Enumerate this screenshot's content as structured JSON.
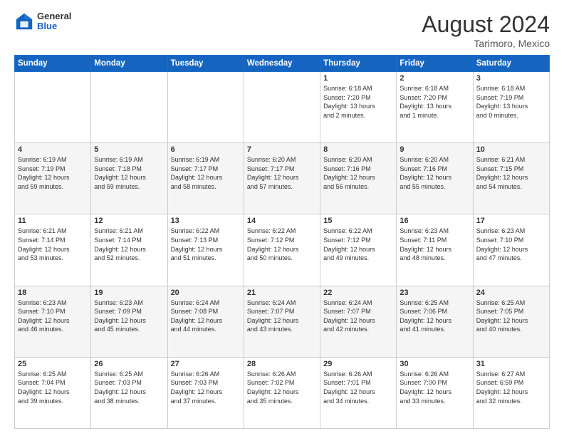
{
  "header": {
    "logo": {
      "general": "General",
      "blue": "Blue"
    },
    "title": "August 2024",
    "location": "Tarimoro, Mexico"
  },
  "weekdays": [
    "Sunday",
    "Monday",
    "Tuesday",
    "Wednesday",
    "Thursday",
    "Friday",
    "Saturday"
  ],
  "weeks": [
    [
      {
        "day": "",
        "info": ""
      },
      {
        "day": "",
        "info": ""
      },
      {
        "day": "",
        "info": ""
      },
      {
        "day": "",
        "info": ""
      },
      {
        "day": "1",
        "info": "Sunrise: 6:18 AM\nSunset: 7:20 PM\nDaylight: 13 hours\nand 2 minutes."
      },
      {
        "day": "2",
        "info": "Sunrise: 6:18 AM\nSunset: 7:20 PM\nDaylight: 13 hours\nand 1 minute."
      },
      {
        "day": "3",
        "info": "Sunrise: 6:18 AM\nSunset: 7:19 PM\nDaylight: 13 hours\nand 0 minutes."
      }
    ],
    [
      {
        "day": "4",
        "info": "Sunrise: 6:19 AM\nSunset: 7:19 PM\nDaylight: 12 hours\nand 59 minutes."
      },
      {
        "day": "5",
        "info": "Sunrise: 6:19 AM\nSunset: 7:18 PM\nDaylight: 12 hours\nand 59 minutes."
      },
      {
        "day": "6",
        "info": "Sunrise: 6:19 AM\nSunset: 7:17 PM\nDaylight: 12 hours\nand 58 minutes."
      },
      {
        "day": "7",
        "info": "Sunrise: 6:20 AM\nSunset: 7:17 PM\nDaylight: 12 hours\nand 57 minutes."
      },
      {
        "day": "8",
        "info": "Sunrise: 6:20 AM\nSunset: 7:16 PM\nDaylight: 12 hours\nand 56 minutes."
      },
      {
        "day": "9",
        "info": "Sunrise: 6:20 AM\nSunset: 7:16 PM\nDaylight: 12 hours\nand 55 minutes."
      },
      {
        "day": "10",
        "info": "Sunrise: 6:21 AM\nSunset: 7:15 PM\nDaylight: 12 hours\nand 54 minutes."
      }
    ],
    [
      {
        "day": "11",
        "info": "Sunrise: 6:21 AM\nSunset: 7:14 PM\nDaylight: 12 hours\nand 53 minutes."
      },
      {
        "day": "12",
        "info": "Sunrise: 6:21 AM\nSunset: 7:14 PM\nDaylight: 12 hours\nand 52 minutes."
      },
      {
        "day": "13",
        "info": "Sunrise: 6:22 AM\nSunset: 7:13 PM\nDaylight: 12 hours\nand 51 minutes."
      },
      {
        "day": "14",
        "info": "Sunrise: 6:22 AM\nSunset: 7:12 PM\nDaylight: 12 hours\nand 50 minutes."
      },
      {
        "day": "15",
        "info": "Sunrise: 6:22 AM\nSunset: 7:12 PM\nDaylight: 12 hours\nand 49 minutes."
      },
      {
        "day": "16",
        "info": "Sunrise: 6:23 AM\nSunset: 7:11 PM\nDaylight: 12 hours\nand 48 minutes."
      },
      {
        "day": "17",
        "info": "Sunrise: 6:23 AM\nSunset: 7:10 PM\nDaylight: 12 hours\nand 47 minutes."
      }
    ],
    [
      {
        "day": "18",
        "info": "Sunrise: 6:23 AM\nSunset: 7:10 PM\nDaylight: 12 hours\nand 46 minutes."
      },
      {
        "day": "19",
        "info": "Sunrise: 6:23 AM\nSunset: 7:09 PM\nDaylight: 12 hours\nand 45 minutes."
      },
      {
        "day": "20",
        "info": "Sunrise: 6:24 AM\nSunset: 7:08 PM\nDaylight: 12 hours\nand 44 minutes."
      },
      {
        "day": "21",
        "info": "Sunrise: 6:24 AM\nSunset: 7:07 PM\nDaylight: 12 hours\nand 43 minutes."
      },
      {
        "day": "22",
        "info": "Sunrise: 6:24 AM\nSunset: 7:07 PM\nDaylight: 12 hours\nand 42 minutes."
      },
      {
        "day": "23",
        "info": "Sunrise: 6:25 AM\nSunset: 7:06 PM\nDaylight: 12 hours\nand 41 minutes."
      },
      {
        "day": "24",
        "info": "Sunrise: 6:25 AM\nSunset: 7:05 PM\nDaylight: 12 hours\nand 40 minutes."
      }
    ],
    [
      {
        "day": "25",
        "info": "Sunrise: 6:25 AM\nSunset: 7:04 PM\nDaylight: 12 hours\nand 39 minutes."
      },
      {
        "day": "26",
        "info": "Sunrise: 6:25 AM\nSunset: 7:03 PM\nDaylight: 12 hours\nand 38 minutes."
      },
      {
        "day": "27",
        "info": "Sunrise: 6:26 AM\nSunset: 7:03 PM\nDaylight: 12 hours\nand 37 minutes."
      },
      {
        "day": "28",
        "info": "Sunrise: 6:26 AM\nSunset: 7:02 PM\nDaylight: 12 hours\nand 35 minutes."
      },
      {
        "day": "29",
        "info": "Sunrise: 6:26 AM\nSunset: 7:01 PM\nDaylight: 12 hours\nand 34 minutes."
      },
      {
        "day": "30",
        "info": "Sunrise: 6:26 AM\nSunset: 7:00 PM\nDaylight: 12 hours\nand 33 minutes."
      },
      {
        "day": "31",
        "info": "Sunrise: 6:27 AM\nSunset: 6:59 PM\nDaylight: 12 hours\nand 32 minutes."
      }
    ]
  ]
}
